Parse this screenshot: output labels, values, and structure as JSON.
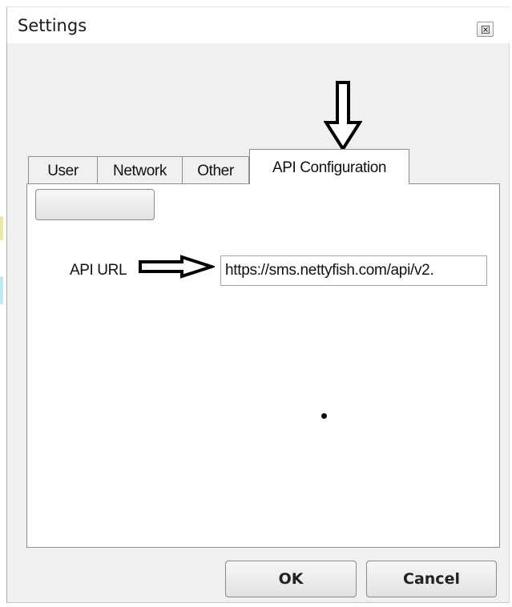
{
  "window": {
    "title": "Settings"
  },
  "tabs": [
    {
      "label": "User"
    },
    {
      "label": "Network"
    },
    {
      "label": "Other"
    },
    {
      "label": "API Configuration",
      "active": true
    }
  ],
  "api_config": {
    "blank_button_label": "",
    "api_url_label": "API URL",
    "api_url_value": "https://sms.nettyfish.com/api/v2."
  },
  "buttons": {
    "ok_label": "OK",
    "cancel_label": "Cancel"
  },
  "icons": {
    "close": "close-icon",
    "annotation_down": "arrow-down-annotation-icon",
    "annotation_right": "arrow-right-annotation-icon"
  },
  "colors": {
    "client_background": "#f0f0f0",
    "panel_background": "#ffffff",
    "border": "#8f8f8f",
    "bleed_yellow": "#e8e8a0",
    "bleed_cyan": "#b8e4ec"
  }
}
